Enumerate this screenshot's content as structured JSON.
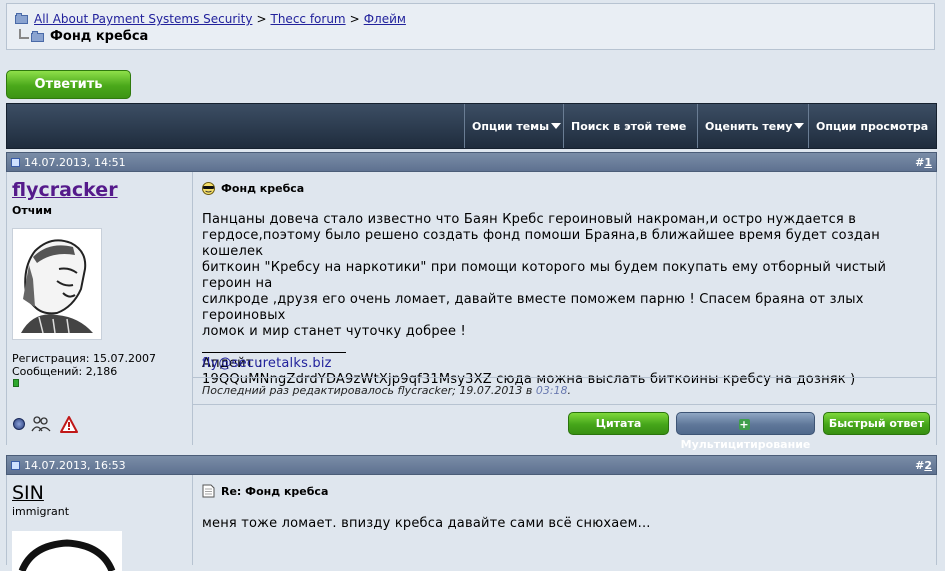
{
  "breadcrumb": {
    "links": [
      "All About Payment Systems Security",
      "Thecc forum",
      "Флейм"
    ],
    "separator": ">",
    "current": "Фонд кребса"
  },
  "reply_button": "Ответить",
  "thread_tools": [
    "Опции темы",
    "Поиск в этой теме",
    "Оценить тему",
    "Опции просмотра"
  ],
  "posts": [
    {
      "date": "14.07.2013, 14:51",
      "number_prefix": "#",
      "number": "1",
      "username": "flycracker",
      "user_title": "Отчим",
      "reg_date": "Регистрация: 15.07.2007",
      "post_count": "Сообщений: 2,186",
      "title": "Фонд кребса",
      "body_lines": [
        "Панцаны довеча стало известно что Баян Кребс героиновый накроман,и остро нуждается в",
        "гердосе,поэтому было решено создать фонд помоши Браяна,в ближайшее время будет создан кошелек",
        "биткоин \"Кребсу на наркотики\" при помощи которого мы будем покупать ему отборный чистый героин на",
        "силкроде ,друзя его очень ломает, давайте вместе поможем парню ! Спасем браяна от злых героиновых",
        "ломок и мир станет чуточку добрее !"
      ],
      "update_label": "Апдейт :",
      "update_line": "19QQuMNngZdrdYDA9zWtXjp9qf31Msy3XZ сюда можна выслать биткоины кребсу на дозняк )",
      "signature_link": "fly@securetalks.biz",
      "edited_prefix": "Последний раз редактировалось flycracker; 19.07.2013 в ",
      "edited_time": "03:18",
      "edited_suffix": ".",
      "buttons": [
        "Цитата",
        "Мультицитирование",
        "Быстрый ответ"
      ]
    },
    {
      "date": "14.07.2013, 16:53",
      "number_prefix": "#",
      "number": "2",
      "username": "SIN",
      "user_title": "immigrant",
      "title": "Re: Фонд кребса",
      "body": "меня тоже ломает. впизду кребса давайте сами всё снюхаем..."
    }
  ],
  "colors": {
    "reply_green": "#4aa81a",
    "toolbar_dark": "#1f2c3d",
    "post_header": "#6a7d9a",
    "link": "#22229c",
    "username": "#551a8b"
  }
}
